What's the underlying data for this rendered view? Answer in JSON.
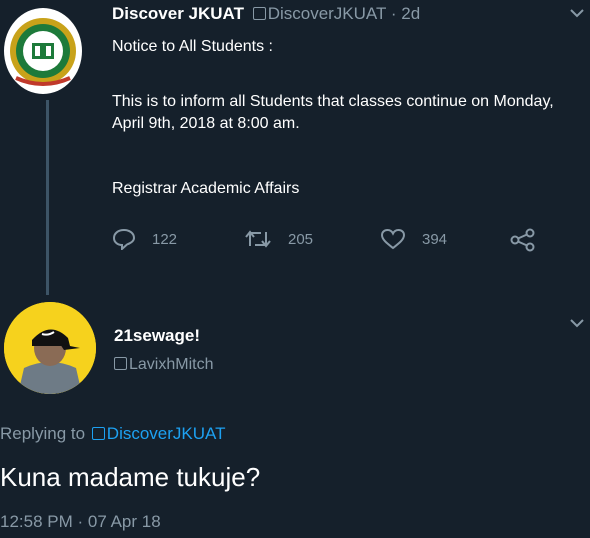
{
  "tweet": {
    "display_name": "Discover JKUAT",
    "handle": "DiscoverJKUAT",
    "separator": "·",
    "time": "2d",
    "text_notice": "Notice to All Students :",
    "text_body": "This is to inform all Students that classes continue on Monday, April 9th, 2018 at 8:00 am.",
    "text_signature": "Registrar Academic Affairs",
    "reply_count": "122",
    "retweet_count": "205",
    "like_count": "394"
  },
  "reply": {
    "display_name": "21sewage!",
    "handle": "LavixhMitch",
    "replying_prefix": "Replying to",
    "replying_handle": "DiscoverJKUAT",
    "text": "Kuna madame tukuje?",
    "timestamp": "12:58 PM · 07 Apr 18"
  },
  "colors": {
    "background": "#15202b",
    "muted": "#8899a6",
    "link": "#1da1f2",
    "avatar_yellow": "#f6d21d"
  },
  "icons": [
    "reply-icon",
    "retweet-icon",
    "like-icon",
    "share-icon",
    "chevron-down-icon",
    "verified-icon"
  ]
}
